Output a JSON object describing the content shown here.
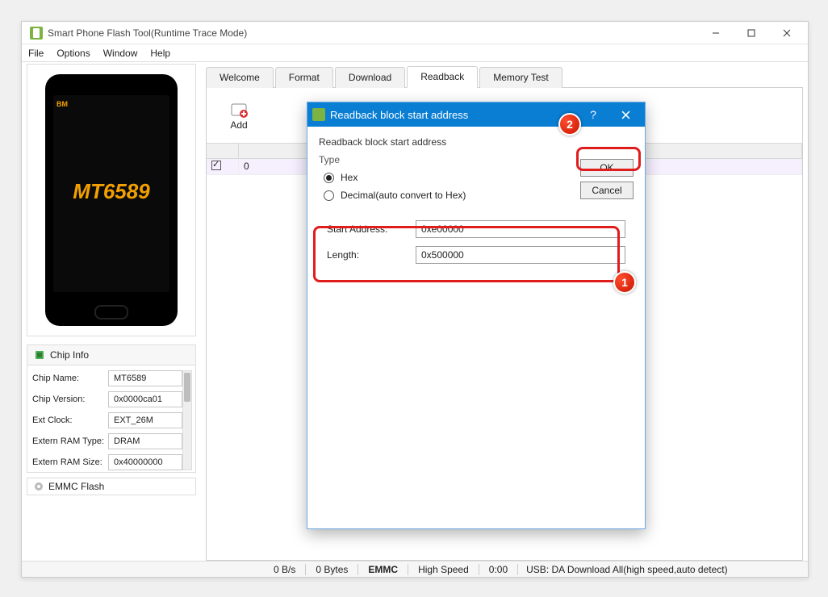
{
  "window": {
    "title": "Smart Phone Flash Tool(Runtime Trace Mode)"
  },
  "menu": {
    "file": "File",
    "options": "Options",
    "window": "Window",
    "help": "Help"
  },
  "phone": {
    "brand": "BM",
    "chip": "MT6589"
  },
  "chip_panel": {
    "title": "Chip Info",
    "rows": {
      "name_lbl": "Chip Name:",
      "name_val": "MT6589",
      "ver_lbl": "Chip Version:",
      "ver_val": "0x0000ca01",
      "clk_lbl": "Ext Clock:",
      "clk_val": "EXT_26M",
      "ramt_lbl": "Extern RAM Type:",
      "ramt_val": "DRAM",
      "rams_lbl": "Extern RAM Size:",
      "rams_val": "0x40000000"
    }
  },
  "emmc": {
    "label": "EMMC Flash"
  },
  "tabs": {
    "welcome": "Welcome",
    "format": "Format",
    "download": "Download",
    "readback": "Readback",
    "memtest": "Memory Test"
  },
  "toolbar": {
    "add": "Add"
  },
  "grid": {
    "row0_col1": "0"
  },
  "status": {
    "speed": "0 B/s",
    "bytes": "0 Bytes",
    "iface": "EMMC",
    "mode": "High Speed",
    "time": "0:00",
    "usb": "USB: DA Download All(high speed,auto detect)"
  },
  "dialog": {
    "title": "Readback block start address",
    "heading": "Readback block start address",
    "type_label": "Type",
    "hex": "Hex",
    "decimal": "Decimal(auto convert to Hex)",
    "start_lbl": "Start Address:",
    "start_val": "0xe00000",
    "len_lbl": "Length:",
    "len_val": "0x500000",
    "ok": "OK",
    "cancel": "Cancel",
    "help": "?"
  },
  "markers": {
    "one": "1",
    "two": "2"
  }
}
